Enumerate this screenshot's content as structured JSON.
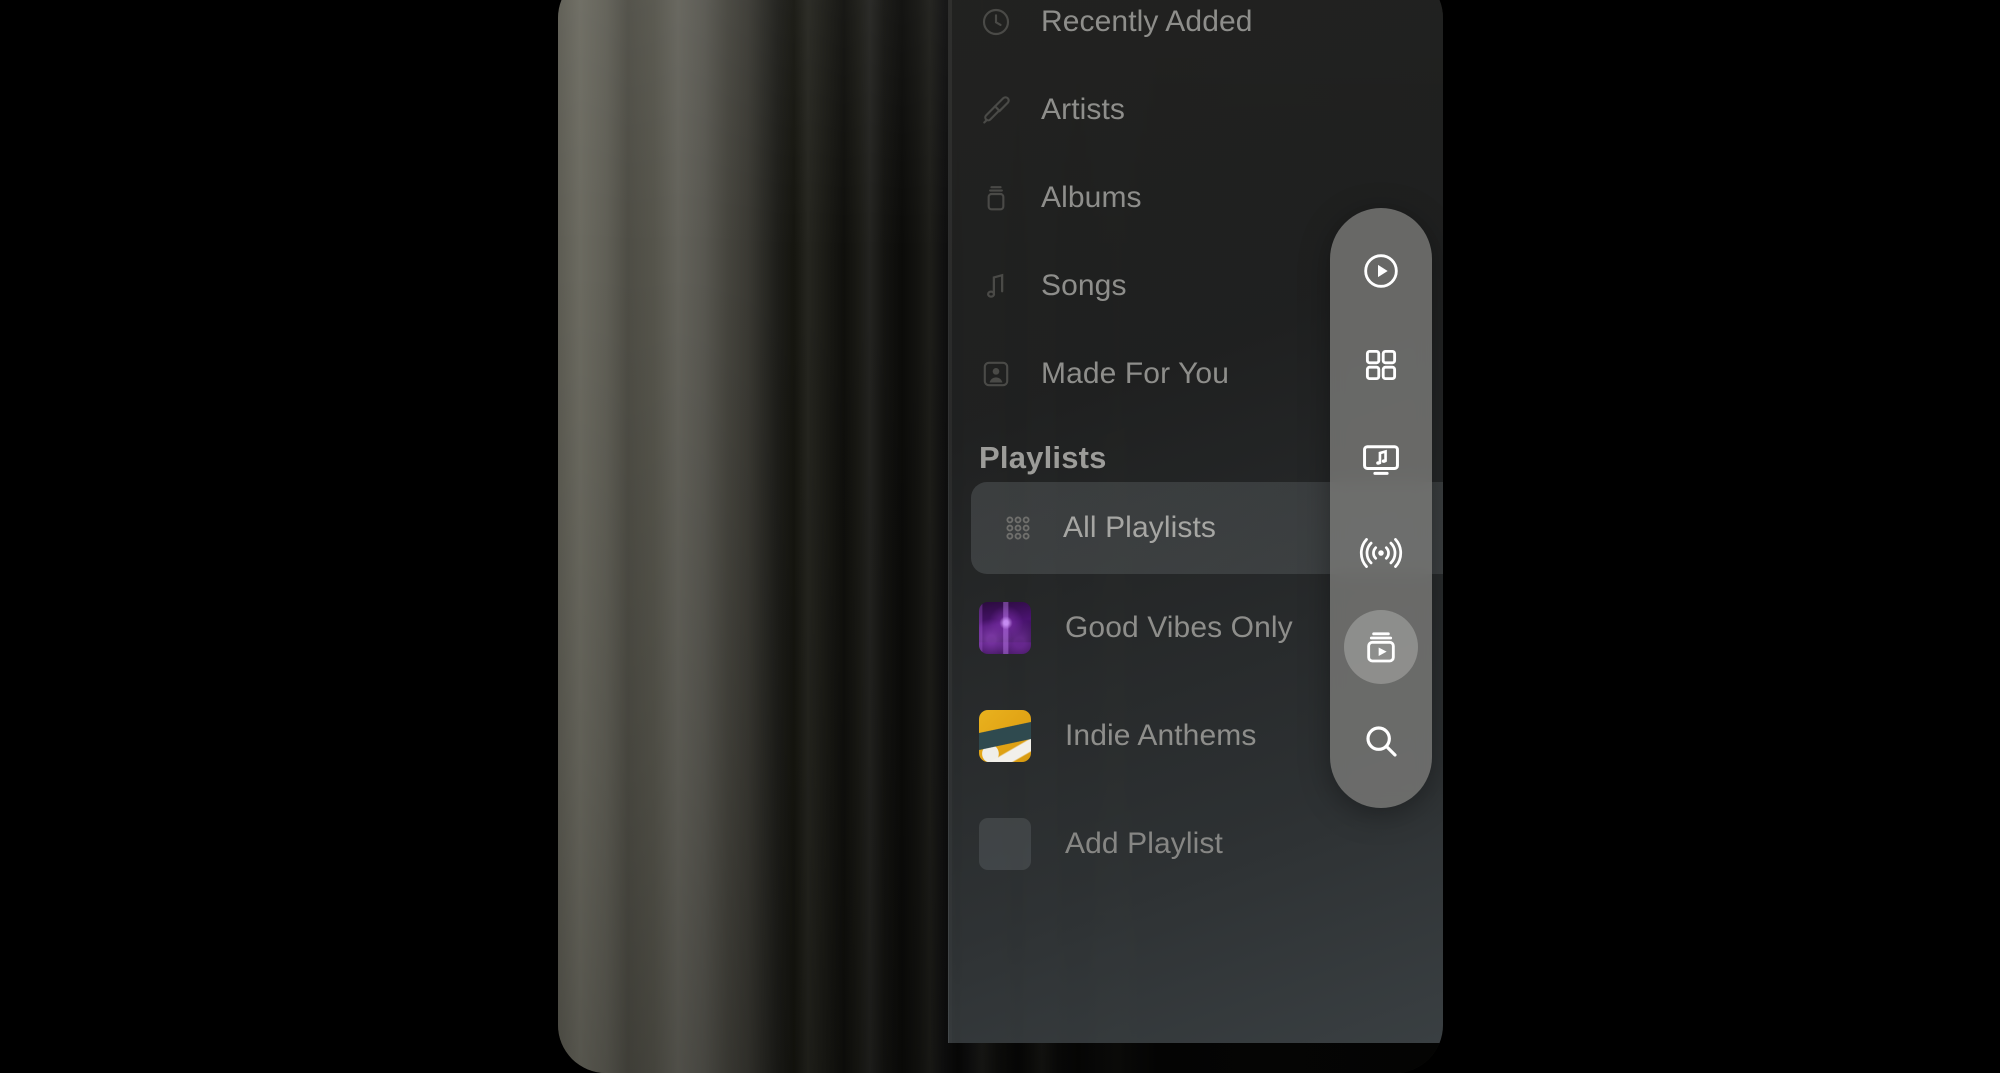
{
  "window": {
    "background_description": "dark curtain photo backdrop",
    "corner_radius_px": 48
  },
  "sidebar": {
    "nav_items": [
      {
        "label": "Recently Added",
        "icon": "clock-icon",
        "selected": false
      },
      {
        "label": "Artists",
        "icon": "microphone-icon",
        "selected": false
      },
      {
        "label": "Albums",
        "icon": "album-stack-icon",
        "selected": false
      },
      {
        "label": "Songs",
        "icon": "music-note-icon",
        "selected": false
      },
      {
        "label": "Made For You",
        "icon": "person-square-icon",
        "selected": false
      }
    ],
    "section_heading": "Playlists",
    "playlist_items": [
      {
        "label": "All Playlists",
        "icon": "grid-dots-icon",
        "selected": true,
        "art": null
      },
      {
        "label": "Good Vibes Only",
        "icon": null,
        "selected": false,
        "art": "art-vibes"
      },
      {
        "label": "Indie Anthems",
        "icon": null,
        "selected": false,
        "art": "art-indie"
      },
      {
        "label": "Add Playlist",
        "icon": null,
        "selected": false,
        "art": "art-add"
      }
    ],
    "colors": {
      "panel_bg": "#222220",
      "panel_bg_bottom": "#3e4447",
      "label_text": "#8e8e8b",
      "heading_text": "#9c9c99",
      "icon_muted": "#4a4a47",
      "selected_row_bg": "#767c7f"
    }
  },
  "toolbar": {
    "buttons": [
      {
        "name": "play-circle-icon",
        "label": "Now Playing",
        "active": false
      },
      {
        "name": "grid-squares-icon",
        "label": "Browse",
        "active": false
      },
      {
        "name": "music-video-icon",
        "label": "Music Videos",
        "active": false
      },
      {
        "name": "radio-waves-icon",
        "label": "Radio",
        "active": false
      },
      {
        "name": "playlist-play-icon",
        "label": "Playlists",
        "active": true
      },
      {
        "name": "search-icon",
        "label": "Search",
        "active": false
      }
    ],
    "colors": {
      "bar_bg": "#7a7a78",
      "icon": "#ffffff",
      "active_pill": "#e1e1de"
    }
  }
}
